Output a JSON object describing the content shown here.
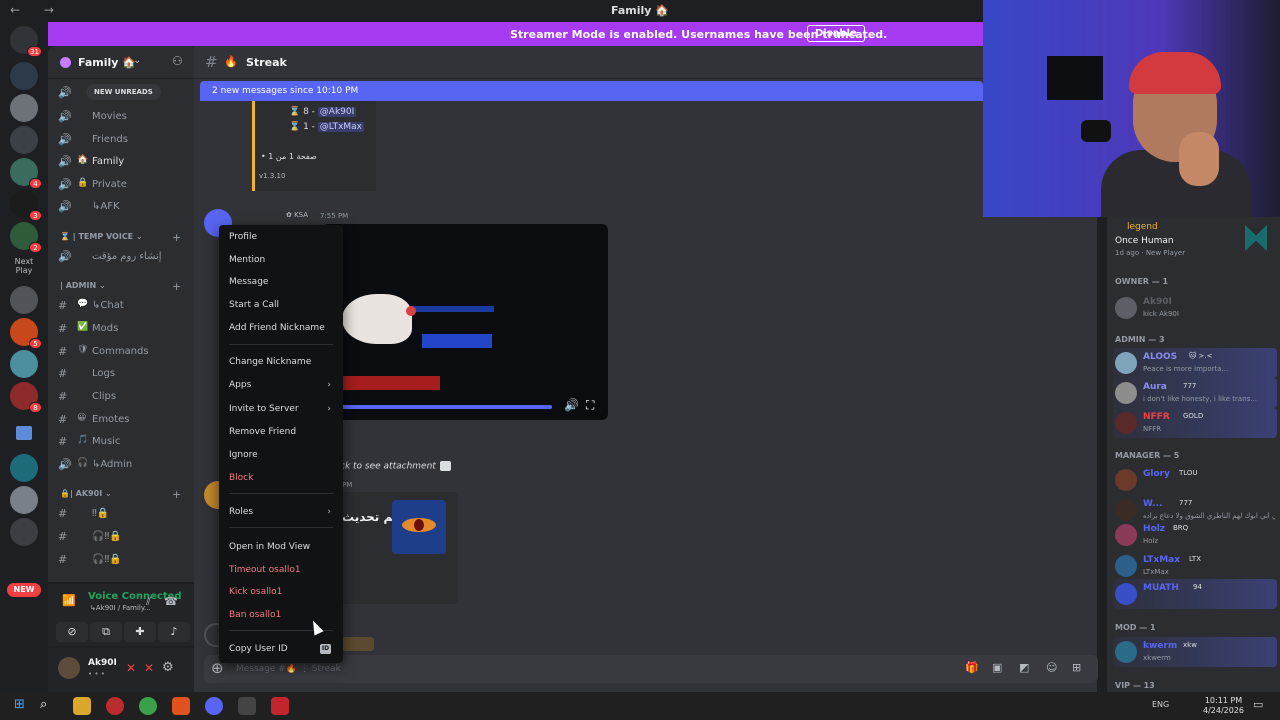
{
  "window": {
    "title": "Family 🏠",
    "nav": "← →"
  },
  "rail": {
    "badges": [
      "31",
      "4",
      "3",
      "2",
      "5",
      "8"
    ],
    "next_play": "Next Play",
    "new_pill": "NEW"
  },
  "banner": {
    "text": "Streamer Mode is enabled. Usernames have been truncated.",
    "button": "Disable"
  },
  "server": {
    "name": "Family 🏠",
    "chevron": "⌄"
  },
  "sidebar": {
    "new_unreads": "NEW UNREADS",
    "voice_channels": [
      {
        "label": "Movies",
        "emoji": ""
      },
      {
        "label": "Friends",
        "emoji": ""
      },
      {
        "label": "Family",
        "emoji": "🏠"
      },
      {
        "label": "Private",
        "emoji": "🔒"
      },
      {
        "label": "↳AFK",
        "emoji": ""
      }
    ],
    "cat_temp": "⌛ | TEMP VOICE ⌄",
    "temp_channel": "إنشاء روم مؤقت",
    "cat_admin": "| ADMIN ⌄",
    "admin_channels": [
      {
        "label": "↳Chat",
        "emoji": "💬"
      },
      {
        "label": "Mods",
        "emoji": "✅"
      },
      {
        "label": "Commands",
        "emoji": "🛡"
      },
      {
        "label": "Logs",
        "emoji": ""
      },
      {
        "label": "Clips",
        "emoji": ""
      },
      {
        "label": "Emotes",
        "emoji": "😀"
      },
      {
        "label": "Music",
        "emoji": "🎵"
      },
      {
        "label": "↳Admin",
        "emoji": "🎧"
      }
    ],
    "cat_ak": "🔒| AK90I ⌄",
    "plus": "+"
  },
  "voice": {
    "status": "Voice Connected",
    "channel": "↳Ak90I / Family..."
  },
  "user": {
    "name": "Ak90I",
    "status": "• • •"
  },
  "chat": {
    "channel_name": "Streak",
    "new_messages": "2 new messages since 10:10 PM",
    "embed": {
      "rows": [
        {
          "rank": "8 -",
          "user": "@Ak90I"
        },
        {
          "rank": "1 -",
          "user": "@LTxMax"
        }
      ],
      "page": "• صفحة 1 من 1",
      "version": "v1.3.10"
    },
    "msg1_tag": "KSA",
    "msg1_time": "7:55 PM",
    "attachment_text": "ck to see attachment",
    "msg2_time": "PM",
    "card_text": "تم تحديث",
    "input_placeholder": "Message #🔥 ⋮ Streak"
  },
  "context_menu": {
    "items": [
      "Profile",
      "Mention",
      "Message",
      "Start a Call",
      "Add Friend Nickname",
      "Change Nickname",
      "Apps",
      "Invite to Server",
      "Remove Friend",
      "Ignore",
      "Block",
      "Roles",
      "Open in Mod View",
      "Timeout osallo1",
      "Kick osallo1",
      "Ban osallo1",
      "Copy User ID"
    ],
    "submenu_arrow": "›",
    "id_tag": "ID"
  },
  "members": {
    "activity": {
      "title": "legend",
      "game": "Once Human",
      "meta": "1d ago  ·  New Player"
    },
    "groups": {
      "owner": "OWNER — 1",
      "admin": "ADMIN — 3",
      "manager": "MANAGER — 5",
      "mod": "MOD — 1",
      "vip": "VIP — 13"
    },
    "owner": [
      {
        "name": "Ak90I",
        "tag": "",
        "sub": "kick Ak90I",
        "color": "#5c5f66"
      }
    ],
    "admins": [
      {
        "name": "ALOOS",
        "tag": "🐱 >.<",
        "sub": "Peace is more importa...",
        "color": "#8a8df0"
      },
      {
        "name": "Aura",
        "tag": "777",
        "sub": "i don't like honesty, i like trans...",
        "color": "#8a8df0"
      },
      {
        "name": "NFFR",
        "tag": "GOLD",
        "sub": "NFFR",
        "color": "#f23f43"
      }
    ],
    "managers": [
      {
        "name": "Glory",
        "tag": "TLOU",
        "sub": "",
        "color": "#5865f2"
      },
      {
        "name": "W...",
        "tag": "777",
        "sub": "ربي اني ابوك لهم الناطري الشوق ولا دعاع براده",
        "color": "#5865f2"
      },
      {
        "name": "Holz",
        "tag": "BRQ",
        "sub": "Holz",
        "color": "#5865f2"
      },
      {
        "name": "LTxMax",
        "tag": "LTX",
        "sub": "LTxMax",
        "color": "#5865f2"
      },
      {
        "name": "MUATH",
        "tag": "94",
        "sub": "",
        "color": "#5865f2"
      }
    ],
    "mods": [
      {
        "name": "kwerm",
        "tag": "xkw",
        "sub": "xkwerm",
        "color": "#5865f2"
      }
    ]
  },
  "taskbar": {
    "lang": "ENG",
    "time": "10:11 PM",
    "date": "4/24/2026"
  },
  "colors": {
    "banner": "#a53af1",
    "blurple": "#5865f2",
    "danger": "#f47a85",
    "voice_green": "#23a55a"
  }
}
